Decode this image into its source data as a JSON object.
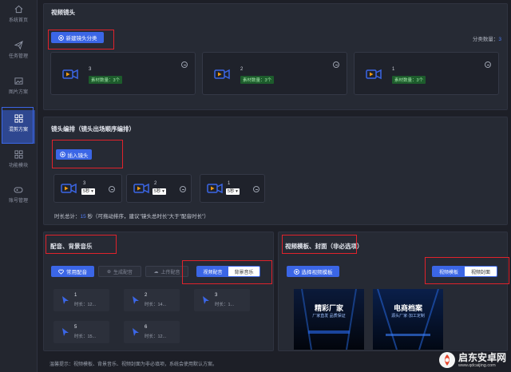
{
  "sidebar": {
    "items": [
      {
        "label": "系统首页",
        "icon": "home-icon"
      },
      {
        "label": "任务管理",
        "icon": "send-icon"
      },
      {
        "label": "图片方案",
        "icon": "image-icon"
      },
      {
        "label": "混剪方案",
        "icon": "grid-icon",
        "active": true
      },
      {
        "label": "功能模块",
        "icon": "modules-icon"
      },
      {
        "label": "账号管理",
        "icon": "gamepad-icon"
      }
    ]
  },
  "video_shots": {
    "title": "视频镜头",
    "new_button": "新建镜头分类",
    "count_label": "分类数量：",
    "count_value": "3",
    "cards": [
      {
        "number": "3",
        "badge": "素材数量：3个"
      },
      {
        "number": "2",
        "badge": "素材数量：3个"
      },
      {
        "number": "1",
        "badge": "素材数量：3个"
      }
    ]
  },
  "shot_order": {
    "title": "镜头编排（镜头出场顺序编排）",
    "insert_button": "插入镜头",
    "items": [
      {
        "number": "3",
        "duration": "5秒"
      },
      {
        "number": "2",
        "duration": "5秒"
      },
      {
        "number": "1",
        "duration": "5秒"
      }
    ],
    "total_prefix": "时长总计：",
    "total_value": "15",
    "total_suffix": "秒（可拖动排序，建议\"镜头总时长\"大于\"配音时长\"）"
  },
  "audio": {
    "title": "配音、背景音乐",
    "btn_common": "常用配音",
    "btn_generate": "生成配音",
    "btn_upload": "上传配音",
    "toggle_on": "视频配音",
    "toggle_off": "背景音乐",
    "items": [
      {
        "name": "1",
        "duration": "时长：12..."
      },
      {
        "name": "2",
        "duration": "时长：14..."
      },
      {
        "name": "3",
        "duration": "时长：1..."
      },
      {
        "name": "5",
        "duration": "时长：15..."
      },
      {
        "name": "6",
        "duration": "时长：12..."
      }
    ]
  },
  "template": {
    "title": "视频模板、封面（非必选项）",
    "select_button": "选择视频模板",
    "toggle_on": "视频模板",
    "toggle_off": "视频封面",
    "thumbs": [
      {
        "title": "精彩厂家",
        "subtitle": "厂家直发 品质保证"
      },
      {
        "title": "电商档案",
        "subtitle": "源头厂家·加工定制"
      }
    ]
  },
  "footer": {
    "tip": "温馨提示：视频模板、背景音乐、视频封面为非必填项，系统会使用默认方案。"
  },
  "watermark": {
    "text": "启东安卓网",
    "url": "www.qdcaijing.com"
  }
}
